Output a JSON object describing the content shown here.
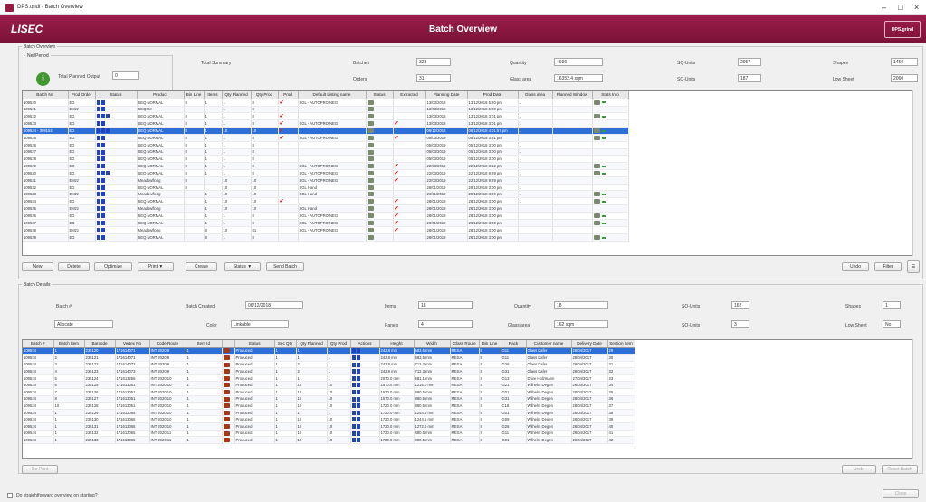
{
  "window": {
    "title": "DPS.ondi - Batch Overview",
    "min": "–",
    "max": "□",
    "close": "×"
  },
  "banner": {
    "logo": "LISEC",
    "title": "Batch Overview",
    "brand": "DPS.grind"
  },
  "overview": {
    "group_label": "Batch Overview",
    "sub_label": "Net/Period",
    "info_icon": "info-icon",
    "field_label_1": "Total Planned Output",
    "field_value_1": "0",
    "summary_label": "Total Summary",
    "row1": [
      {
        "label": "Batches",
        "value": "328"
      },
      {
        "label": "Quantity",
        "value": "4936"
      },
      {
        "label": "SQ-Units",
        "value": "2957"
      },
      {
        "label": "Shapes",
        "value": "1450"
      }
    ],
    "row2": [
      {
        "label": "Orders",
        "value": "31"
      },
      {
        "label": "Glass area",
        "value": "16352.4 sqm"
      },
      {
        "label": "SQ-Units",
        "value": "187"
      },
      {
        "label": "Low Sheet",
        "value": "2060"
      }
    ]
  },
  "batch_grid": {
    "columns": [
      "Batch No",
      "Prod Order",
      "Status",
      "Product",
      "Bin Line",
      "Items",
      "Qty Planned",
      "Qty Prod",
      "Prod",
      "Default Listing name",
      "Status",
      "Extracted",
      "Planning Date",
      "Prod Date",
      "Glass area",
      "Planned Window",
      "Stats Info"
    ],
    "rows": [
      [
        "109520",
        "EG",
        "mix",
        "SEQ NORMAL",
        "8",
        "1",
        "1",
        "8",
        "yes",
        "SGL - AUTOPRO NEG",
        "st",
        "",
        "13/03/2018",
        "13/12/2018 5:20 pm",
        "1",
        "",
        "g1"
      ],
      [
        "109521",
        "EMzz",
        "mix",
        "SEQSM",
        "",
        "",
        "1",
        "8",
        "",
        "",
        "st",
        "",
        "13/03/2018",
        "13/12/2018 5:00 pm",
        "",
        "",
        ""
      ],
      [
        "109522",
        "EG",
        "mix2",
        "SEQ NORMAL",
        "8",
        "1",
        "1",
        "8",
        "yes",
        "",
        "st",
        "",
        "13/03/2018",
        "13/12/2018 3:01 pm",
        "1",
        "",
        "g2"
      ],
      [
        "109523",
        "EG",
        "mix",
        "SEQ NORMAL",
        "8",
        "1",
        "1",
        "8",
        "yes",
        "SGL - AUTOPRO NEG",
        "st",
        "yes",
        "13/03/2018",
        "13/12/2018 3:01 pm",
        "1",
        "",
        ""
      ],
      [
        "109524 - 309152",
        "EG",
        "mix3",
        "SEQ NORMAL",
        "8",
        "1",
        "10",
        "10",
        "yes",
        "",
        "st",
        "",
        "06/12/2018",
        "06/12/2018 4:01:57 pm",
        "1",
        "",
        "g1"
      ],
      [
        "109525",
        "EG",
        "mix",
        "SEQ NORMAL",
        "8",
        "1",
        "1",
        "8",
        "yes",
        "SGL - AUTOPRO NEG",
        "st",
        "yes",
        "05/03/2019",
        "05/12/2018 3:31 pm",
        "",
        "",
        "g2"
      ],
      [
        "109526",
        "EG",
        "mix",
        "SEQ NORMAL",
        "8",
        "1",
        "1",
        "8",
        "",
        "",
        "st",
        "",
        "05/03/2019",
        "05/12/2018 3:00 pm",
        "1",
        "",
        ""
      ],
      [
        "109527",
        "EG",
        "mix",
        "SEQ NORMAL",
        "8",
        "1",
        "1",
        "8",
        "",
        "",
        "st",
        "",
        "05/03/2019",
        "05/12/2018 3:00 pm",
        "1",
        "",
        ""
      ],
      [
        "109528",
        "EG",
        "mix",
        "SEQ NORMAL",
        "8",
        "1",
        "1",
        "8",
        "",
        "",
        "st",
        "",
        "05/03/2019",
        "05/12/2018 3:00 pm",
        "1",
        "",
        ""
      ],
      [
        "109529",
        "EG",
        "mix",
        "SEQ NORMAL",
        "8",
        "1",
        "1",
        "8",
        "",
        "SGL - AUTOPRO NEG",
        "st",
        "yes",
        "22/03/2019",
        "22/12/2018 3:12 pm",
        "",
        "",
        "g1"
      ],
      [
        "109530",
        "EG",
        "mix2",
        "SEQ NORMAL",
        "8",
        "1",
        "1",
        "8",
        "",
        "SGL - AUTOPRO NEG",
        "st",
        "yes",
        "22/03/2019",
        "22/12/2018 9:29 pm",
        "1",
        "",
        "g2"
      ],
      [
        "109531",
        "EMzz",
        "mix",
        "Meadowflong",
        "8",
        "",
        "10",
        "10",
        "",
        "SGL - AUTOPRO NEG",
        "st",
        "yes",
        "22/03/2019",
        "22/12/2018 9:29 pm",
        "",
        "",
        ""
      ],
      [
        "109532",
        "EG",
        "mix",
        "SEQ NORMAL",
        "8",
        "",
        "10",
        "10",
        "",
        "SGL Hand",
        "st",
        "",
        "28/01/2019",
        "28/12/2018 3:00 pm",
        "1",
        "",
        ""
      ],
      [
        "109533",
        "EMzz",
        "mix",
        "Meadowflong",
        "",
        "1",
        "10",
        "10",
        "",
        "SGL Hand",
        "st",
        "",
        "28/01/2019",
        "28/12/2018 3:00 pm",
        "1",
        "",
        "g1"
      ],
      [
        "109534",
        "EG",
        "mix",
        "SEQ NORMAL",
        "",
        "1",
        "10",
        "10",
        "yes",
        "",
        "st",
        "yes",
        "28/01/2019",
        "28/12/2018 3:00 pm",
        "1",
        "",
        "g2"
      ],
      [
        "109535",
        "EMzz",
        "mix",
        "Meadowflong",
        "",
        "1",
        "10",
        "10",
        "",
        "SGL Hand",
        "st",
        "yes",
        "28/01/2019",
        "28/12/2018 3:00 pm",
        "",
        "",
        ""
      ],
      [
        "109536",
        "EG",
        "mix",
        "SEQ NORMAL",
        "",
        "1",
        "1",
        "8",
        "",
        "SGL - AUTOPRO NEG",
        "st",
        "yes",
        "28/01/2019",
        "28/12/2018 3:00 pm",
        "",
        "",
        "g1"
      ],
      [
        "109537",
        "EG",
        "mix",
        "SEQ NORMAL",
        "",
        "1",
        "1",
        "8",
        "",
        "SGL - AUTOPRO NEG",
        "st",
        "yes",
        "28/01/2019",
        "28/12/2018 3:00 pm",
        "",
        "",
        "g2"
      ],
      [
        "109538",
        "EMzz",
        "mix",
        "Meadowflong",
        "",
        "8",
        "10",
        "81",
        "",
        "SGL - AUTOPRO NEG",
        "st",
        "yes",
        "28/01/2019",
        "28/12/2018 3:00 pm",
        "",
        "",
        ""
      ],
      [
        "109539",
        "EG",
        "mix",
        "SEQ NORMAL",
        "",
        "8",
        "1",
        "8",
        "",
        "",
        "st",
        "",
        "28/01/2019",
        "28/12/2018 3:00 pm",
        "",
        "",
        "g1"
      ]
    ]
  },
  "batch_buttons": {
    "new": "New",
    "delete": "Delete",
    "optimize": "Optimize",
    "print": "Print ▼",
    "create": "Create",
    "status": "Status ▼",
    "send": "Send Batch",
    "undo": "Undo",
    "filter": "Filter"
  },
  "details": {
    "group_label": "Batch Details",
    "batch_label": "Batch #",
    "r1": [
      {
        "label": "Batch Created",
        "value": "06/12/2018"
      },
      {
        "label": "Items",
        "value": "18"
      },
      {
        "label": "Quantity",
        "value": "18"
      },
      {
        "label": "SQ-Units",
        "value": "162"
      },
      {
        "label": "Shapes",
        "value": "1"
      }
    ],
    "r2_value0": "Allocate",
    "r2": [
      {
        "label": "Color",
        "value": "Linkable"
      },
      {
        "label": "Panels",
        "value": "4"
      },
      {
        "label": "Glass area",
        "value": "162 sqm"
      },
      {
        "label": "SQ-Units",
        "value": "3"
      },
      {
        "label": "Low Sheet",
        "value": "No"
      }
    ]
  },
  "detail_grid": {
    "columns": [
      "Batch #",
      "Batch Item",
      "Barcode",
      "Vertex No",
      "Code Route",
      "Item Id",
      "",
      "Status",
      "Sec Qty",
      "Qty Planned",
      "Qty Prod",
      "Actions",
      "Height",
      "Width",
      "Glass Route",
      "Bin Line",
      "Rack",
      "Customer name",
      "Delivery Date",
      "Section Item"
    ],
    "rows": [
      [
        "109524",
        "1",
        "235120",
        "171614071",
        "INT 2020 9",
        "1",
        "t",
        "Produced",
        "1",
        "1",
        "1",
        "b",
        "242.8 mm",
        "583.5 mm",
        "MESA",
        "8",
        "G11",
        "Glass Kafer",
        "28/04/2017",
        "29"
      ],
      [
        "109524",
        "2",
        "235121",
        "171614071",
        "INT 2020 9",
        "1",
        "t",
        "Produced",
        "1",
        "1",
        "1",
        "b",
        "242.8 mm",
        "583.5 mm",
        "MESA",
        "8",
        "G11",
        "Glass Kafer",
        "28/04/2017",
        "30"
      ],
      [
        "109524",
        "3",
        "235122",
        "171614072",
        "INT 2020 9",
        "1",
        "t",
        "Produced",
        "1",
        "2",
        "1",
        "b",
        "242.8 mm",
        "712.3 mm",
        "MESA",
        "8",
        "G26",
        "Glass Kafer",
        "28/04/2017",
        "31"
      ],
      [
        "109524",
        "4",
        "235123",
        "171614073",
        "INT 2020 9",
        "1",
        "t",
        "Produced",
        "1",
        "2",
        "1",
        "b",
        "242.8 mm",
        "712.3 mm",
        "MESA",
        "8",
        "G31",
        "Glass Kafer",
        "28/04/2017",
        "32"
      ],
      [
        "109524",
        "5",
        "235124",
        "171613256",
        "INT 2020 10",
        "1",
        "t",
        "Produced",
        "1",
        "1",
        "1",
        "b",
        "2070.0 mm",
        "581.1 mm",
        "MESA",
        "8",
        "G13",
        "Drive Holzmann",
        "27/04/2017",
        "33"
      ],
      [
        "109524",
        "6",
        "235125",
        "171613051",
        "INT 2020 10",
        "1",
        "t",
        "Produced",
        "1",
        "10",
        "10",
        "b",
        "1570.0 mm",
        "1215.0 mm",
        "MESA",
        "8",
        "G21",
        "Wilhelm Degen",
        "28/04/2017",
        "34"
      ],
      [
        "109524",
        "7",
        "235126",
        "171613051",
        "INT 2020 10",
        "1",
        "t",
        "Produced",
        "1",
        "10",
        "10",
        "b",
        "1570.0 mm",
        "880.5 mm",
        "MESA",
        "8",
        "G01",
        "Wilhelm Degen",
        "28/04/2017",
        "35"
      ],
      [
        "109524",
        "8",
        "235127",
        "171613051",
        "INT 2020 10",
        "1",
        "t",
        "Produced",
        "1",
        "10",
        "10",
        "b",
        "1570.0 mm",
        "880.5 mm",
        "MESA",
        "8",
        "G31",
        "Wilhelm Degen",
        "28/04/2017",
        "36"
      ],
      [
        "109524",
        "10",
        "235128",
        "171613051",
        "INT 2020 10",
        "1",
        "t",
        "Produced",
        "1",
        "10",
        "10",
        "b",
        "1720.0 mm",
        "880.5 mm",
        "MESA",
        "8",
        "C18",
        "Wilhelm Degen",
        "28/04/2017",
        "37"
      ],
      [
        "109524",
        "1",
        "235129",
        "171613065",
        "INT 2020 10",
        "1",
        "t",
        "Produced",
        "1",
        "1",
        "1",
        "b",
        "1720.0 mm",
        "1244.5 mm",
        "MESA",
        "8",
        "G01",
        "Wilhelm Degen",
        "28/04/2017",
        "38"
      ],
      [
        "109524",
        "1",
        "235130",
        "171613065",
        "INT 2020 10",
        "1",
        "t",
        "Produced",
        "1",
        "10",
        "10",
        "b",
        "1720.0 mm",
        "1244.5 mm",
        "MESA",
        "8",
        "G09",
        "Wilhelm Degen",
        "28/04/2017",
        "39"
      ],
      [
        "109524",
        "1",
        "235131",
        "171613065",
        "INT 2020 10",
        "1",
        "t",
        "Produced",
        "1",
        "10",
        "10",
        "b",
        "1720.0 mm",
        "1272.0 mm",
        "MESA",
        "8",
        "G26",
        "Wilhelm Degen",
        "28/04/2017",
        "40"
      ],
      [
        "109524",
        "1",
        "235132",
        "171613065",
        "INT 2020 11",
        "1",
        "t",
        "Produced",
        "1",
        "10",
        "10",
        "b",
        "1720.0 mm",
        "880.5 mm",
        "MESA",
        "8",
        "G11",
        "Wilhelm Degen",
        "28/04/2017",
        "41"
      ],
      [
        "109524",
        "1",
        "235133",
        "171613065",
        "INT 2020 11",
        "1",
        "t",
        "Produced",
        "1",
        "10",
        "10",
        "b",
        "1720.0 mm",
        "880.5 mm",
        "MESA",
        "8",
        "G01",
        "Wilhelm Degen",
        "28/04/2017",
        "42"
      ]
    ]
  },
  "detail_buttons": {
    "reprint": "Re-Print",
    "left": "Undo",
    "right": "Reset Batch"
  },
  "footer": {
    "checkbox_label": "Do straightforward overview on starting?",
    "close": "Close"
  }
}
